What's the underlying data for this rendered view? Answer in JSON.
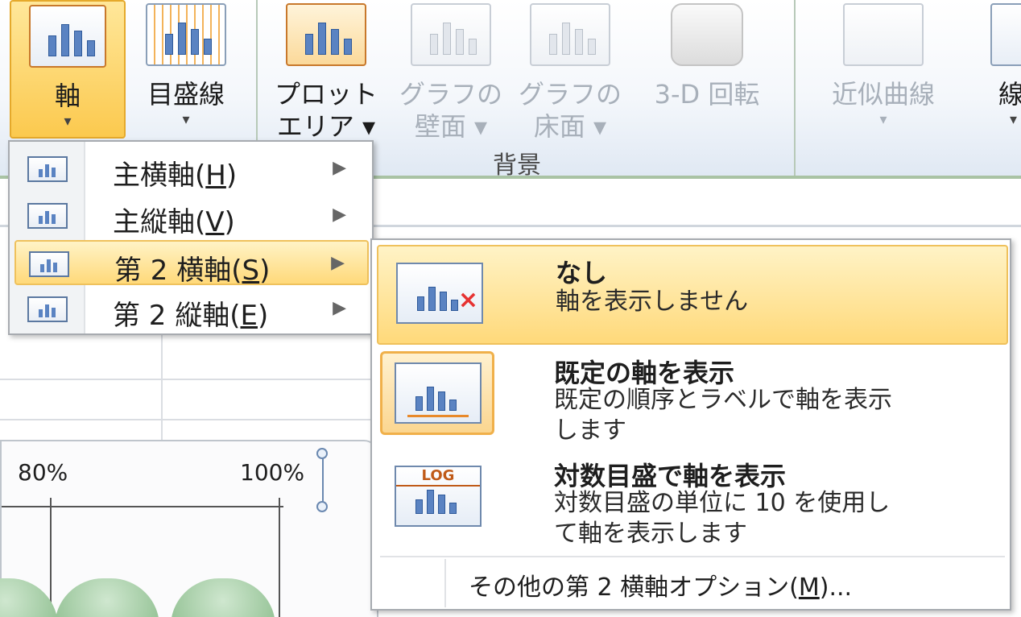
{
  "ribbon": {
    "buttons": [
      {
        "label": "軸",
        "arrow": "▾",
        "state": "active"
      },
      {
        "label": "目盛線",
        "arrow": "▾",
        "state": "normal"
      },
      {
        "label1": "プロット",
        "label2": "エリア ▾",
        "state": "normal"
      },
      {
        "label1": "グラフの",
        "label2": "壁面 ▾",
        "state": "disabled"
      },
      {
        "label1": "グラフの",
        "label2": "床面 ▾",
        "state": "disabled"
      },
      {
        "label": "3-D 回転",
        "state": "disabled"
      },
      {
        "label": "近似曲線",
        "arrow": "▾",
        "state": "disabled"
      },
      {
        "label": "線",
        "arrow": "▾",
        "state": "normal"
      }
    ],
    "group_background_label": "背景"
  },
  "axis_menu": {
    "items": [
      {
        "label": "主横軸(",
        "key": "H",
        "suffix": ")"
      },
      {
        "label": "主縦軸(",
        "key": "V",
        "suffix": ")"
      },
      {
        "label": "第 2 横軸(",
        "key": "S",
        "suffix": ")"
      },
      {
        "label": "第 2 縦軸(",
        "key": "E",
        "suffix": ")"
      }
    ],
    "arrow": "▶"
  },
  "secondary_horizontal_submenu": {
    "options": [
      {
        "title": "なし",
        "desc": [
          "軸を表示しません"
        ]
      },
      {
        "title": "既定の軸を表示",
        "desc": [
          "既定の順序とラベルで軸を表示",
          "します"
        ]
      },
      {
        "title": "対数目盛で軸を表示",
        "desc": [
          "対数目盛の単位に 10 を使用し",
          "て軸を表示します"
        ],
        "icon_text": "LOG"
      }
    ],
    "more_options": {
      "label": "その他の第 2 横軸オプション(",
      "key": "M",
      "suffix": ")..."
    }
  },
  "chart": {
    "tick_labels": [
      "80%",
      "100%"
    ]
  },
  "colors": {
    "highlight": "#ffd97a",
    "highlight_border": "#efc15c",
    "ribbon_green_line": "#a9c3a4",
    "bar_blue": "#5a83c2",
    "close_red": "#e63232"
  }
}
